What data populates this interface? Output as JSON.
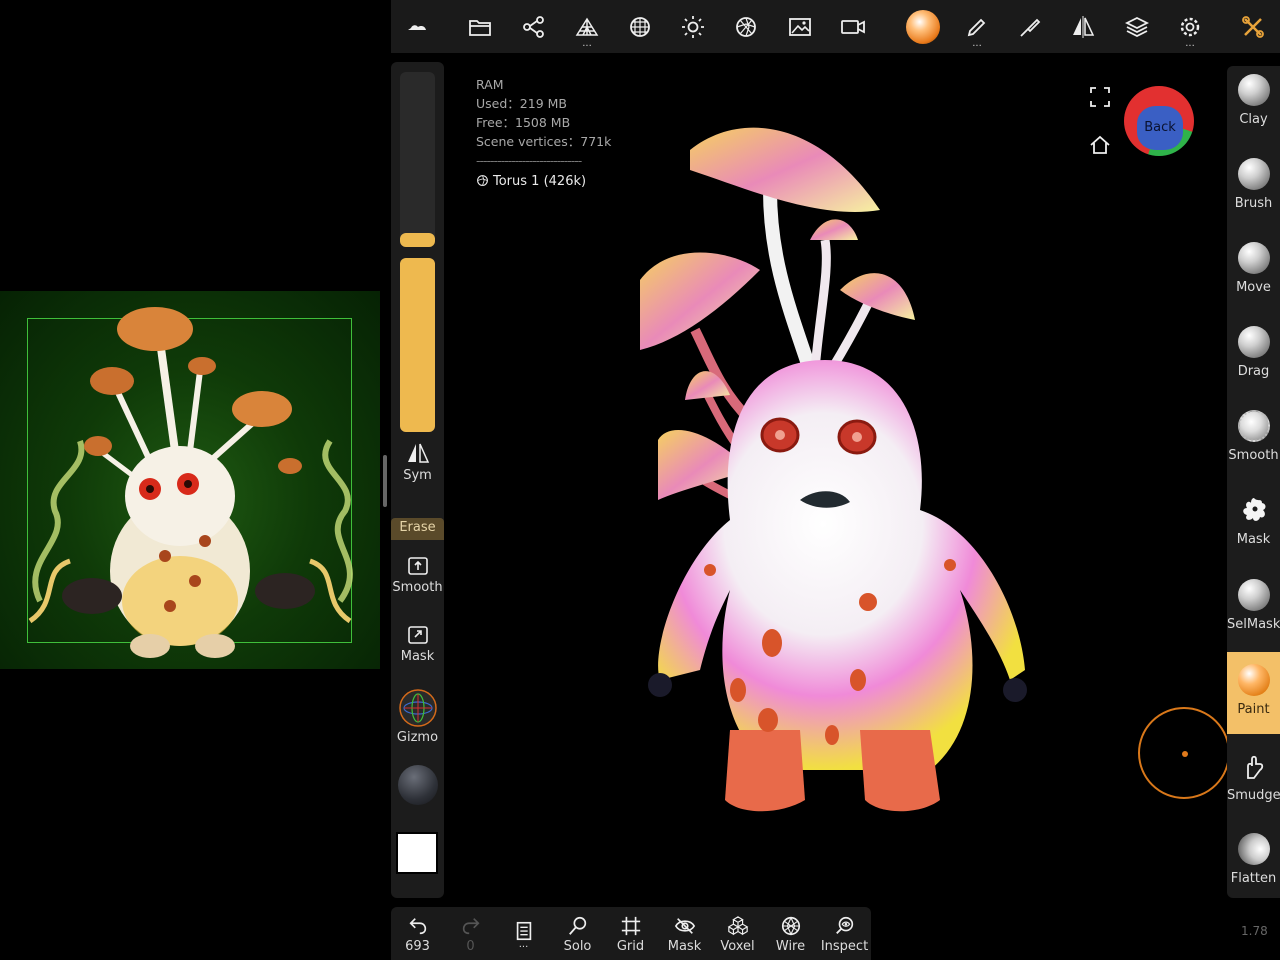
{
  "top_toolbar": {
    "items": [
      "cloud-icon",
      "folder-icon",
      "scene-graph-icon",
      "topology-icon",
      "mesh-sphere-icon",
      "light-icon",
      "material-icon",
      "background-image-icon",
      "camera-icon",
      "material-ball",
      "paint-brush-icon",
      "stroke-icon",
      "symmetry-icon",
      "layers-icon",
      "settings-icon",
      "tools-icon"
    ],
    "more_indicator": "..."
  },
  "stats": {
    "ram_label": "RAM",
    "used": "Used：219 MB",
    "free": "Free：1508 MB",
    "vertices": "Scene vertices：771k",
    "separator": "------------------------------",
    "mesh_name": "Torus 1 (426k)"
  },
  "left_toolbar": {
    "radius_level": 0.08,
    "intensity_level": 1.0,
    "sym_label": "Sym",
    "erase_label": "Erase",
    "smooth_label": "Smooth",
    "mask_label": "Mask",
    "gizmo_label": "Gizmo",
    "color_swatch": "#ffffff"
  },
  "bottom_toolbar": {
    "undo_count": "693",
    "redo_count": "0",
    "more": "...",
    "solo": "Solo",
    "grid": "Grid",
    "mask": "Mask",
    "voxel": "Voxel",
    "wire": "Wire",
    "inspect": "Inspect"
  },
  "right_toolbar": {
    "tools": [
      {
        "label": "Clay"
      },
      {
        "label": "Brush"
      },
      {
        "label": "Move"
      },
      {
        "label": "Drag"
      },
      {
        "label": "Smooth"
      },
      {
        "label": "Mask"
      },
      {
        "label": "SelMask"
      },
      {
        "label": "Paint",
        "active": true
      },
      {
        "label": "Smudge"
      },
      {
        "label": "Flatten"
      }
    ]
  },
  "view_cube": {
    "face_label": "Back"
  },
  "version": "1.78",
  "colors": {
    "accent": "#eeb94f",
    "active_tool": "#f3c068",
    "cursor": "#d9781a"
  }
}
